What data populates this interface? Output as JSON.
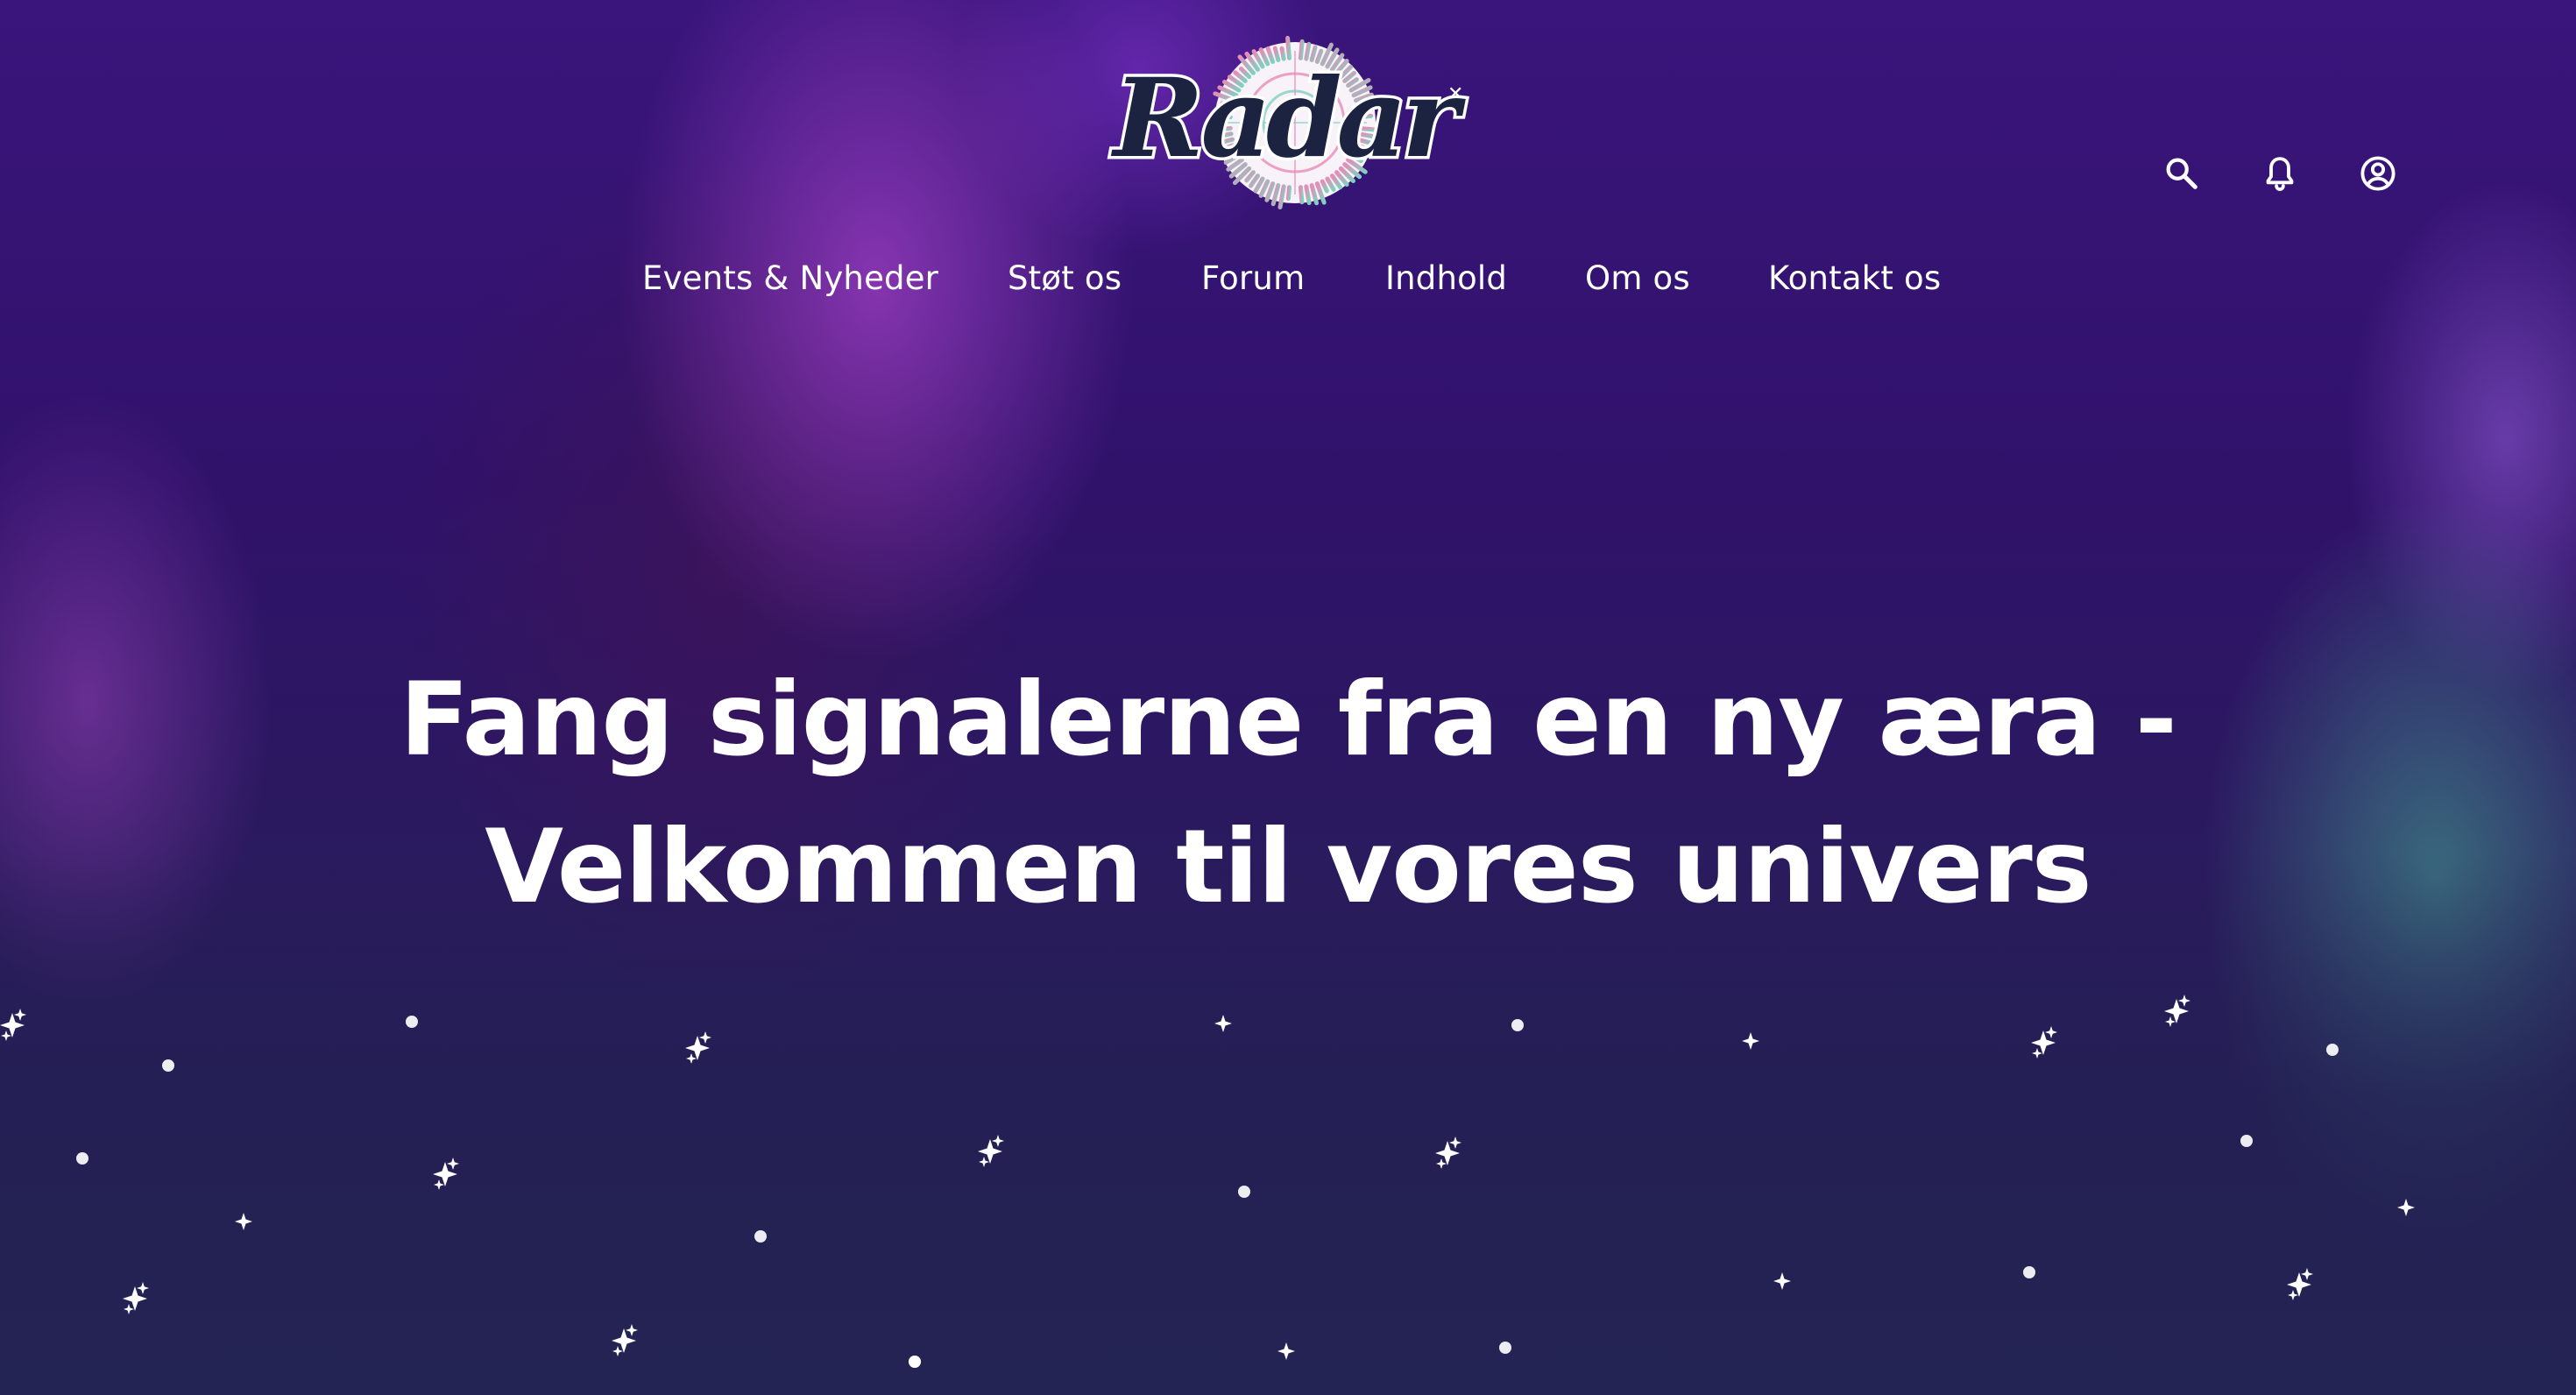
{
  "brand": {
    "logo_text": "Radar"
  },
  "header_icons": [
    {
      "name": "search-icon"
    },
    {
      "name": "bell-icon"
    },
    {
      "name": "account-icon"
    }
  ],
  "nav": {
    "items": [
      {
        "label": "Events & Nyheder"
      },
      {
        "label": "Støt os"
      },
      {
        "label": "Forum"
      },
      {
        "label": "Indhold"
      },
      {
        "label": "Om os"
      },
      {
        "label": "Kontakt os"
      }
    ]
  },
  "hero": {
    "headline_line1": "Fang signalerne fra en ny æra -",
    "headline_line2": "Velkommen til vores univers"
  },
  "colors": {
    "background_top": "#3a157c",
    "background_bottom": "#26214f",
    "text": "#ffffff",
    "logo_ink": "#1c2340",
    "logo_pink": "#e88bb8",
    "logo_teal": "#7fd1c0"
  }
}
